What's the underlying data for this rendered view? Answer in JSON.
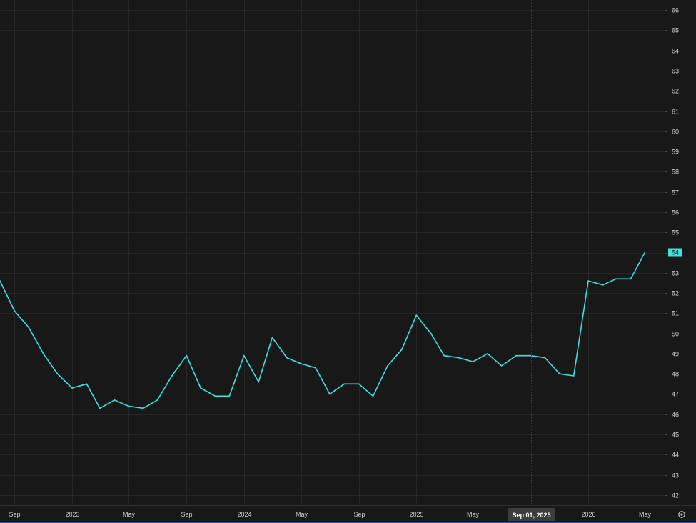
{
  "chart_data": {
    "type": "line",
    "title": "",
    "xlabel": "",
    "ylabel": "",
    "ylim": [
      41.5,
      66.5
    ],
    "y_ticks": [
      42,
      43,
      44,
      45,
      46,
      47,
      48,
      49,
      50,
      51,
      52,
      53,
      54,
      55,
      56,
      57,
      58,
      59,
      60,
      61,
      62,
      63,
      64,
      65,
      66
    ],
    "x_ticks": [
      {
        "label": "Sep",
        "date": "2022-09-01"
      },
      {
        "label": "2023",
        "date": "2023-01-01"
      },
      {
        "label": "May",
        "date": "2023-05-01"
      },
      {
        "label": "Sep",
        "date": "2023-09-01"
      },
      {
        "label": "2024",
        "date": "2024-01-01"
      },
      {
        "label": "May",
        "date": "2024-05-01"
      },
      {
        "label": "Sep",
        "date": "2024-09-01"
      },
      {
        "label": "2025",
        "date": "2025-01-01"
      },
      {
        "label": "May",
        "date": "2025-05-01"
      },
      {
        "label": "2026",
        "date": "2026-01-01"
      },
      {
        "label": "May",
        "date": "2026-05-01"
      }
    ],
    "x_range": [
      "2022-08-01",
      "2026-06-12"
    ],
    "grid": true,
    "crosshair": {
      "date": "2025-09-01",
      "label": "Sep 01, 2025"
    },
    "last_value_label": "54",
    "series": [
      {
        "color": "#3fe0e0",
        "x": [
          "2022-08-01",
          "2022-09-01",
          "2022-10-01",
          "2022-11-01",
          "2022-12-01",
          "2023-01-01",
          "2023-02-01",
          "2023-03-01",
          "2023-04-01",
          "2023-05-01",
          "2023-06-01",
          "2023-07-01",
          "2023-08-01",
          "2023-09-01",
          "2023-10-01",
          "2023-11-01",
          "2023-12-01",
          "2024-01-01",
          "2024-02-01",
          "2024-03-01",
          "2024-04-01",
          "2024-05-01",
          "2024-06-01",
          "2024-07-01",
          "2024-08-01",
          "2024-09-01",
          "2024-10-01",
          "2024-11-01",
          "2024-12-01",
          "2025-01-01",
          "2025-02-01",
          "2025-03-01",
          "2025-04-01",
          "2025-05-01",
          "2025-06-01",
          "2025-07-01",
          "2025-08-01",
          "2025-09-01",
          "2025-10-01",
          "2025-11-01",
          "2025-12-01",
          "2026-01-01",
          "2026-02-01",
          "2026-03-01",
          "2026-04-01",
          "2026-05-01"
        ],
        "values": [
          52.6,
          51.1,
          50.3,
          49.0,
          48.0,
          47.3,
          47.5,
          46.3,
          46.7,
          46.4,
          46.3,
          46.7,
          47.9,
          48.9,
          47.3,
          46.9,
          46.9,
          48.9,
          47.6,
          49.8,
          48.8,
          48.5,
          48.3,
          47.0,
          47.5,
          47.5,
          46.9,
          48.4,
          49.2,
          50.9,
          50.0,
          48.9,
          48.8,
          48.6,
          49.0,
          48.4,
          48.9,
          48.9,
          48.8,
          48.0,
          47.9,
          52.6,
          52.4,
          52.7,
          52.7,
          54.0
        ]
      }
    ]
  },
  "icons": {
    "settings": "gear-icon"
  }
}
